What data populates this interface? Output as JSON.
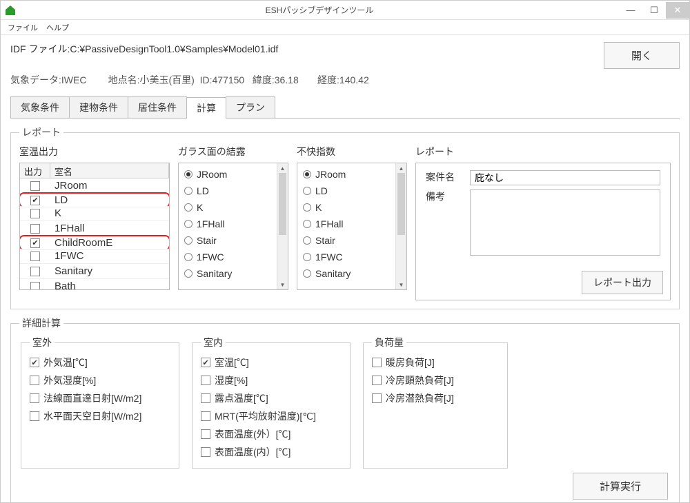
{
  "window": {
    "title": "ESHパッシブデザインツール"
  },
  "menu": {
    "file": "ファイル",
    "help": "ヘルプ"
  },
  "file": {
    "label": "IDF ファイル:",
    "path": "C:¥PassiveDesignTool1.0¥Samples¥Model01.idf",
    "open": "開く"
  },
  "meta": {
    "weather_label": "気象データ:",
    "weather": "IWEC",
    "station_label": "地点名:",
    "station": "小美玉(百里)",
    "id_label": "ID:",
    "id": "477150",
    "lat_label": "緯度:",
    "lat": "36.18",
    "lon_label": "経度:",
    "lon": "140.42"
  },
  "tabs": [
    "気象条件",
    "建物条件",
    "居住条件",
    "計算",
    "プラン"
  ],
  "active_tab": "計算",
  "report_group": "レポート",
  "room_output": {
    "title": "室温出力",
    "col_out": "出力",
    "col_room": "室名",
    "rooms": [
      {
        "name": "JRoom",
        "checked": false,
        "hl": false
      },
      {
        "name": "LD",
        "checked": true,
        "hl": true
      },
      {
        "name": "K",
        "checked": false,
        "hl": false
      },
      {
        "name": "1FHall",
        "checked": false,
        "hl": false
      },
      {
        "name": "ChildRoomE",
        "checked": true,
        "hl": true
      },
      {
        "name": "1FWC",
        "checked": false,
        "hl": false
      },
      {
        "name": "Sanitary",
        "checked": false,
        "hl": false
      },
      {
        "name": "Bath",
        "checked": false,
        "hl": false
      }
    ]
  },
  "condensation": {
    "title": "ガラス面の結露",
    "items": [
      "JRoom",
      "LD",
      "K",
      "1FHall",
      "Stair",
      "1FWC",
      "Sanitary"
    ],
    "selected": "JRoom"
  },
  "discomfort": {
    "title": "不快指数",
    "items": [
      "JRoom",
      "LD",
      "K",
      "1FHall",
      "Stair",
      "1FWC",
      "Sanitary"
    ],
    "selected": "JRoom"
  },
  "report_form": {
    "title": "レポート",
    "case_label": "案件名",
    "case_value": "庇なし",
    "memo_label": "備考",
    "memo_value": "",
    "output_btn": "レポート出力"
  },
  "detail_group": "詳細計算",
  "outdoor": {
    "legend": "室外",
    "items": [
      {
        "label": "外気温[℃]",
        "checked": true
      },
      {
        "label": "外気湿度[%]",
        "checked": false
      },
      {
        "label": "法線面直達日射[W/m2]",
        "checked": false
      },
      {
        "label": "水平面天空日射[W/m2]",
        "checked": false
      }
    ]
  },
  "indoor": {
    "legend": "室内",
    "items": [
      {
        "label": "室温[℃]",
        "checked": true
      },
      {
        "label": "湿度[%]",
        "checked": false
      },
      {
        "label": "露点温度[℃]",
        "checked": false
      },
      {
        "label": "MRT(平均放射温度)[℃]",
        "checked": false
      },
      {
        "label": "表面温度(外）[℃]",
        "checked": false
      },
      {
        "label": "表面温度(内）[℃]",
        "checked": false
      }
    ]
  },
  "load": {
    "legend": "負荷量",
    "items": [
      {
        "label": "暖房負荷[J]",
        "checked": false
      },
      {
        "label": "冷房顕熱負荷[J]",
        "checked": false
      },
      {
        "label": "冷房潜熱負荷[J]",
        "checked": false
      }
    ]
  },
  "calc_btn": "計算実行"
}
